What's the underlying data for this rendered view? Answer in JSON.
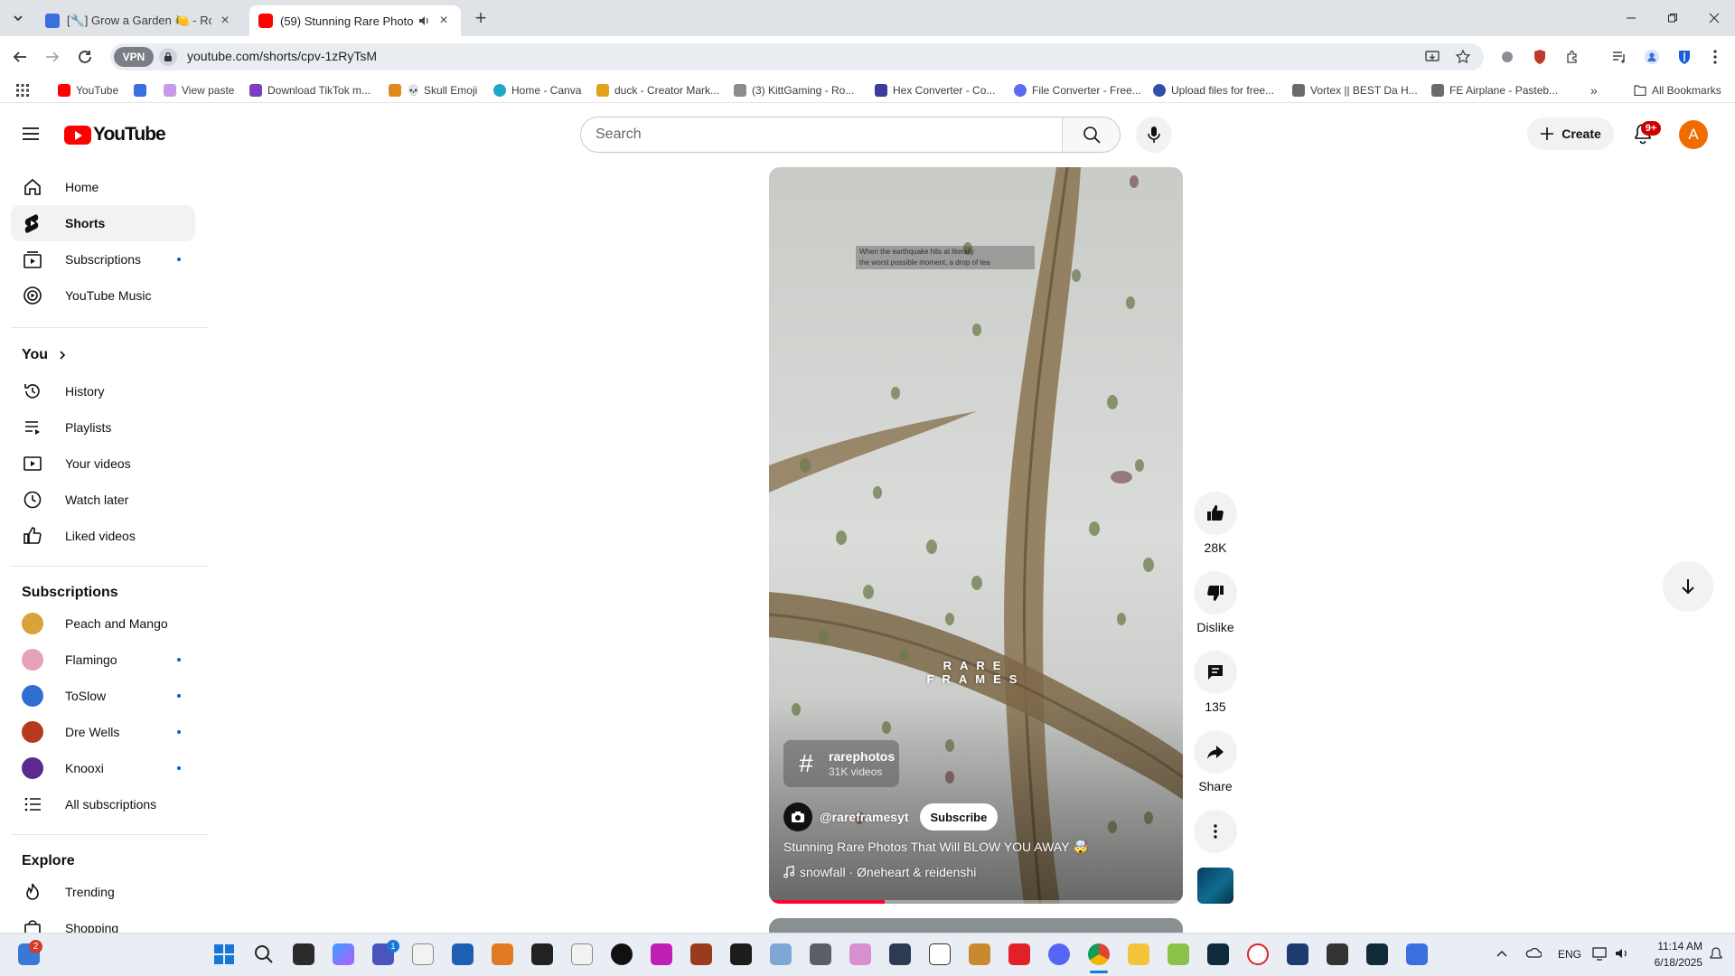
{
  "browser": {
    "tabs": [
      {
        "title": "[🔧] Grow a Garden 🍋 - Roblo",
        "favicon_color": "#3b6fe0"
      },
      {
        "title": "(59) Stunning Rare Photos T",
        "favicon_color": "#ff0000",
        "audio": true
      }
    ],
    "url": "youtube.com/shorts/cpv-1zRyTsM",
    "vpn_label": "VPN",
    "bookmarks": [
      {
        "label": "YouTube",
        "color": "#ff0000"
      },
      {
        "label": "",
        "color": "#3b6fe0"
      },
      {
        "label": "View paste",
        "color": "#c79be6"
      },
      {
        "label": "Download TikTok m...",
        "color": "#7a3fc2"
      },
      {
        "label": "Skull Emoji",
        "color": "#555555"
      },
      {
        "label": "Home - Canva",
        "color": "#1ea7c9"
      },
      {
        "label": "duck - Creator Mark...",
        "color": "#e4a11b"
      },
      {
        "label": "(3) KittGaming - Ro...",
        "color": "#8c8c8c"
      },
      {
        "label": "Hex Converter - Co...",
        "color": "#3b3b9a"
      },
      {
        "label": "File Converter - Free...",
        "color": "#5b6cf0"
      },
      {
        "label": "Upload files for free...",
        "color": "#2d4fa6"
      },
      {
        "label": "Vortex || BEST Da H...",
        "color": "#6b6b6b"
      },
      {
        "label": "FE Airplane - Pasteb...",
        "color": "#6b6b6b"
      }
    ],
    "all_bookmarks": "All Bookmarks"
  },
  "youtube": {
    "logo_text": "YouTube",
    "search_placeholder": "Search",
    "create_label": "Create",
    "notification_badge": "9+",
    "avatar_letter": "A",
    "sidebar": {
      "main": [
        {
          "label": "Home",
          "icon": "home-icon"
        },
        {
          "label": "Shorts",
          "icon": "shorts-icon",
          "active": true
        },
        {
          "label": "Subscriptions",
          "icon": "subscriptions-icon",
          "dot": true
        },
        {
          "label": "YouTube Music",
          "icon": "youtube-music-icon"
        }
      ],
      "you_heading": "You",
      "you": [
        {
          "label": "History",
          "icon": "history-icon"
        },
        {
          "label": "Playlists",
          "icon": "playlists-icon"
        },
        {
          "label": "Your videos",
          "icon": "your-videos-icon"
        },
        {
          "label": "Watch later",
          "icon": "watch-later-icon"
        },
        {
          "label": "Liked videos",
          "icon": "liked-videos-icon"
        }
      ],
      "subscriptions_heading": "Subscriptions",
      "subscriptions": [
        {
          "label": "Peach and Mango",
          "color": "#d9a23b",
          "dot": false
        },
        {
          "label": "Flamingo",
          "color": "#e6a3b5",
          "dot": true
        },
        {
          "label": "ToSlow",
          "color": "#2f6fd0",
          "dot": true
        },
        {
          "label": "Dre Wells",
          "color": "#b83a1e",
          "dot": true
        },
        {
          "label": "Knooxi",
          "color": "#5a2b8f",
          "dot": true
        }
      ],
      "all_subscriptions": "All subscriptions",
      "explore_heading": "Explore",
      "explore": [
        {
          "label": "Trending",
          "icon": "trending-icon"
        },
        {
          "label": "Shopping",
          "icon": "shopping-icon"
        }
      ]
    },
    "short": {
      "video_overlay_text": "RARE FRAMES",
      "video_overlay_caption_line1": "When the earthquake hits at literally",
      "video_overlay_caption_line2": "the worst possible moment, a drop of tea",
      "hashtag": "rarephotos",
      "hashtag_count": "31K videos",
      "channel": "@rareframesyt",
      "subscribe_label": "Subscribe",
      "title": "Stunning Rare Photos That Will BLOW YOU AWAY 🤯",
      "music": "snowfall · Øneheart & reidenshi",
      "progress_fraction": 0.28
    },
    "actions": {
      "likes": "28K",
      "dislike_label": "Dislike",
      "comments": "135",
      "share_label": "Share"
    }
  },
  "taskbar": {
    "widgets_badge": "2",
    "teams_badge": "1",
    "language": "ENG",
    "time": "11:14 AM",
    "date": "6/18/2025"
  }
}
